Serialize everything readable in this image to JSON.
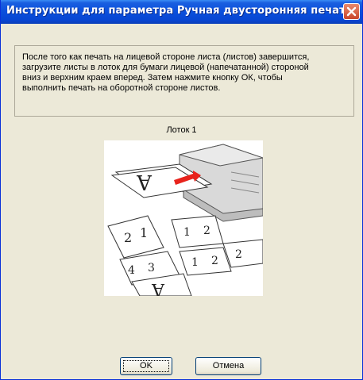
{
  "dialog": {
    "title": "Инструкции для параметра Ручная двусторонняя печать",
    "instruction_lines": [
      "После того как печать на лицевой стороне листа (листов) завершится,",
      "загрузите листы в лоток для бумаги лицевой (напечатанной) стороной",
      "вниз и верхним краем вперед. Затем нажмите кнопку ОК, чтобы",
      "выполнить печать на оборотной стороне листов."
    ],
    "tray_label": "Лоток 1",
    "ok_label": "OK",
    "cancel_label": "Отмена"
  },
  "icons": {
    "close": "close-icon",
    "illustration": "printer-tray-illustration"
  },
  "colors": {
    "titlebar": "#0a4fdc",
    "close_button": "#c9452a",
    "face": "#ece9d8"
  }
}
